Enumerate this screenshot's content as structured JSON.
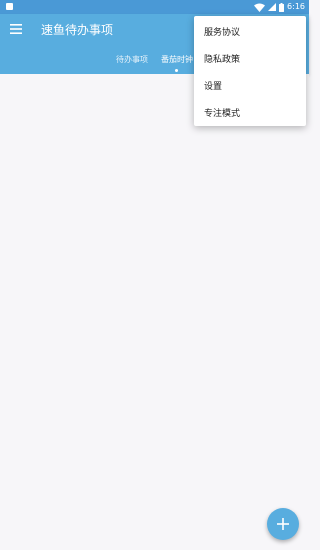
{
  "status_bar": {
    "time": "6:16",
    "icons": [
      "image-notification-icon",
      "wifi-icon",
      "cell-signal-icon",
      "battery-icon"
    ]
  },
  "app_bar": {
    "title": "速鱼待办事项",
    "menu_icon": "hamburger-menu-icon"
  },
  "tabs": [
    {
      "label": "待办事项",
      "selected": false
    },
    {
      "label": "番茄时钟",
      "selected": true
    }
  ],
  "overflow_menu": {
    "items": [
      {
        "label": "服务协议"
      },
      {
        "label": "隐私政策"
      },
      {
        "label": "设置"
      },
      {
        "label": "专注模式"
      }
    ]
  },
  "fab": {
    "icon": "plus-icon"
  },
  "colors": {
    "app_bar": "#58addf",
    "status_bar": "#4a99d6",
    "background": "#f7f6f9",
    "fab": "#58addf"
  }
}
